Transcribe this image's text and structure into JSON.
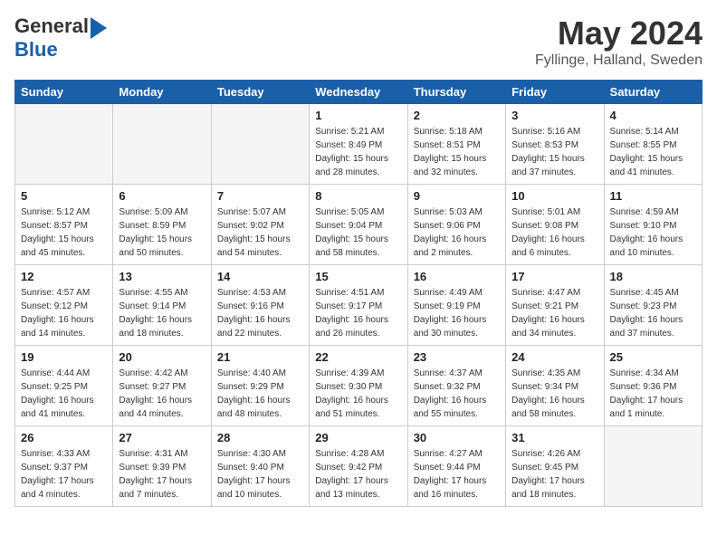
{
  "header": {
    "logo_general": "General",
    "logo_blue": "Blue",
    "title": "May 2024",
    "subtitle": "Fyllinge, Halland, Sweden"
  },
  "days": [
    "Sunday",
    "Monday",
    "Tuesday",
    "Wednesday",
    "Thursday",
    "Friday",
    "Saturday"
  ],
  "weeks": [
    [
      {
        "date": "",
        "info": ""
      },
      {
        "date": "",
        "info": ""
      },
      {
        "date": "",
        "info": ""
      },
      {
        "date": "1",
        "info": "Sunrise: 5:21 AM\nSunset: 8:49 PM\nDaylight: 15 hours\nand 28 minutes."
      },
      {
        "date": "2",
        "info": "Sunrise: 5:18 AM\nSunset: 8:51 PM\nDaylight: 15 hours\nand 32 minutes."
      },
      {
        "date": "3",
        "info": "Sunrise: 5:16 AM\nSunset: 8:53 PM\nDaylight: 15 hours\nand 37 minutes."
      },
      {
        "date": "4",
        "info": "Sunrise: 5:14 AM\nSunset: 8:55 PM\nDaylight: 15 hours\nand 41 minutes."
      }
    ],
    [
      {
        "date": "5",
        "info": "Sunrise: 5:12 AM\nSunset: 8:57 PM\nDaylight: 15 hours\nand 45 minutes."
      },
      {
        "date": "6",
        "info": "Sunrise: 5:09 AM\nSunset: 8:59 PM\nDaylight: 15 hours\nand 50 minutes."
      },
      {
        "date": "7",
        "info": "Sunrise: 5:07 AM\nSunset: 9:02 PM\nDaylight: 15 hours\nand 54 minutes."
      },
      {
        "date": "8",
        "info": "Sunrise: 5:05 AM\nSunset: 9:04 PM\nDaylight: 15 hours\nand 58 minutes."
      },
      {
        "date": "9",
        "info": "Sunrise: 5:03 AM\nSunset: 9:06 PM\nDaylight: 16 hours\nand 2 minutes."
      },
      {
        "date": "10",
        "info": "Sunrise: 5:01 AM\nSunset: 9:08 PM\nDaylight: 16 hours\nand 6 minutes."
      },
      {
        "date": "11",
        "info": "Sunrise: 4:59 AM\nSunset: 9:10 PM\nDaylight: 16 hours\nand 10 minutes."
      }
    ],
    [
      {
        "date": "12",
        "info": "Sunrise: 4:57 AM\nSunset: 9:12 PM\nDaylight: 16 hours\nand 14 minutes."
      },
      {
        "date": "13",
        "info": "Sunrise: 4:55 AM\nSunset: 9:14 PM\nDaylight: 16 hours\nand 18 minutes."
      },
      {
        "date": "14",
        "info": "Sunrise: 4:53 AM\nSunset: 9:16 PM\nDaylight: 16 hours\nand 22 minutes."
      },
      {
        "date": "15",
        "info": "Sunrise: 4:51 AM\nSunset: 9:17 PM\nDaylight: 16 hours\nand 26 minutes."
      },
      {
        "date": "16",
        "info": "Sunrise: 4:49 AM\nSunset: 9:19 PM\nDaylight: 16 hours\nand 30 minutes."
      },
      {
        "date": "17",
        "info": "Sunrise: 4:47 AM\nSunset: 9:21 PM\nDaylight: 16 hours\nand 34 minutes."
      },
      {
        "date": "18",
        "info": "Sunrise: 4:45 AM\nSunset: 9:23 PM\nDaylight: 16 hours\nand 37 minutes."
      }
    ],
    [
      {
        "date": "19",
        "info": "Sunrise: 4:44 AM\nSunset: 9:25 PM\nDaylight: 16 hours\nand 41 minutes."
      },
      {
        "date": "20",
        "info": "Sunrise: 4:42 AM\nSunset: 9:27 PM\nDaylight: 16 hours\nand 44 minutes."
      },
      {
        "date": "21",
        "info": "Sunrise: 4:40 AM\nSunset: 9:29 PM\nDaylight: 16 hours\nand 48 minutes."
      },
      {
        "date": "22",
        "info": "Sunrise: 4:39 AM\nSunset: 9:30 PM\nDaylight: 16 hours\nand 51 minutes."
      },
      {
        "date": "23",
        "info": "Sunrise: 4:37 AM\nSunset: 9:32 PM\nDaylight: 16 hours\nand 55 minutes."
      },
      {
        "date": "24",
        "info": "Sunrise: 4:35 AM\nSunset: 9:34 PM\nDaylight: 16 hours\nand 58 minutes."
      },
      {
        "date": "25",
        "info": "Sunrise: 4:34 AM\nSunset: 9:36 PM\nDaylight: 17 hours\nand 1 minute."
      }
    ],
    [
      {
        "date": "26",
        "info": "Sunrise: 4:33 AM\nSunset: 9:37 PM\nDaylight: 17 hours\nand 4 minutes."
      },
      {
        "date": "27",
        "info": "Sunrise: 4:31 AM\nSunset: 9:39 PM\nDaylight: 17 hours\nand 7 minutes."
      },
      {
        "date": "28",
        "info": "Sunrise: 4:30 AM\nSunset: 9:40 PM\nDaylight: 17 hours\nand 10 minutes."
      },
      {
        "date": "29",
        "info": "Sunrise: 4:28 AM\nSunset: 9:42 PM\nDaylight: 17 hours\nand 13 minutes."
      },
      {
        "date": "30",
        "info": "Sunrise: 4:27 AM\nSunset: 9:44 PM\nDaylight: 17 hours\nand 16 minutes."
      },
      {
        "date": "31",
        "info": "Sunrise: 4:26 AM\nSunset: 9:45 PM\nDaylight: 17 hours\nand 18 minutes."
      },
      {
        "date": "",
        "info": ""
      }
    ]
  ]
}
